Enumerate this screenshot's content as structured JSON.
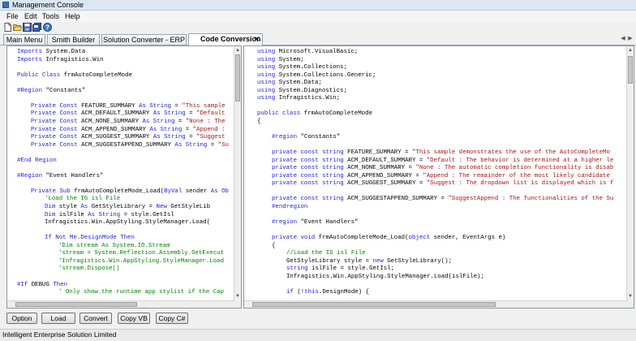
{
  "window": {
    "title": "Management Console"
  },
  "menu": [
    "File",
    "Edit",
    "Tools",
    "Help"
  ],
  "toolbar_icons": [
    "new-file-icon",
    "open-folder-icon",
    "save-icon",
    "save-all-icon",
    "help-icon"
  ],
  "tabs": [
    {
      "label": "Main Menu",
      "active": false
    },
    {
      "label": "Smith Builder",
      "active": false
    },
    {
      "label": "Solution Converter - ERP",
      "active": false
    },
    {
      "label": "Code Conversion",
      "active": true
    }
  ],
  "tab_close_glyph": "✕",
  "tab_nav_glyphs": [
    "◀",
    "▶"
  ],
  "scroll_glyphs": {
    "up": "▲",
    "down": "▼"
  },
  "vb_code": [
    {
      "y": 0,
      "x": 0,
      "t": [
        [
          "kw",
          "Imports "
        ],
        [
          "tx",
          "System.Data"
        ]
      ]
    },
    {
      "y": 1,
      "x": 0,
      "t": [
        [
          "kw",
          "Imports "
        ],
        [
          "tx",
          "Infragistics.Win"
        ]
      ]
    },
    {
      "y": 3,
      "x": 0,
      "t": [
        [
          "kw",
          "Public Class "
        ],
        [
          "tx",
          "frmAutoCompleteMode"
        ]
      ]
    },
    {
      "y": 5,
      "x": 0,
      "t": [
        [
          "kw",
          "#Region "
        ],
        [
          "tx",
          "\"Constants\""
        ]
      ]
    },
    {
      "y": 7,
      "x": 2,
      "t": [
        [
          "kw",
          "Private Const "
        ],
        [
          "tx",
          "FEATURE_SUMMARY "
        ],
        [
          "kw",
          "As String"
        ],
        [
          "tx",
          " = "
        ],
        [
          "str",
          "\"This sample"
        ]
      ]
    },
    {
      "y": 8,
      "x": 2,
      "t": [
        [
          "kw",
          "Private Const "
        ],
        [
          "tx",
          "ACM_DEFAULT_SUMMARY "
        ],
        [
          "kw",
          "As String"
        ],
        [
          "tx",
          " = "
        ],
        [
          "str",
          "\"Default"
        ]
      ]
    },
    {
      "y": 9,
      "x": 2,
      "t": [
        [
          "kw",
          "Private Const "
        ],
        [
          "tx",
          "ACM_NONE_SUMMARY "
        ],
        [
          "kw",
          "As String"
        ],
        [
          "tx",
          " = "
        ],
        [
          "str",
          "\"None : The"
        ]
      ]
    },
    {
      "y": 10,
      "x": 2,
      "t": [
        [
          "kw",
          "Private Const "
        ],
        [
          "tx",
          "ACM_APPEND_SUMMARY "
        ],
        [
          "kw",
          "As String"
        ],
        [
          "tx",
          " = "
        ],
        [
          "str",
          "\"Append :"
        ]
      ]
    },
    {
      "y": 11,
      "x": 2,
      "t": [
        [
          "kw",
          "Private Const "
        ],
        [
          "tx",
          "ACM_SUGGEST_SUMMARY "
        ],
        [
          "kw",
          "As String"
        ],
        [
          "tx",
          " = "
        ],
        [
          "str",
          "\"Suggest"
        ]
      ]
    },
    {
      "y": 12,
      "x": 2,
      "t": [
        [
          "kw",
          "Private Const "
        ],
        [
          "tx",
          "ACM_SUGGESTAPPEND_SUMMARY "
        ],
        [
          "kw",
          "As String"
        ],
        [
          "tx",
          " = "
        ],
        [
          "str",
          "\"Su"
        ]
      ]
    },
    {
      "y": 14,
      "x": 0,
      "t": [
        [
          "kw",
          "#End Region"
        ]
      ]
    },
    {
      "y": 16,
      "x": 0,
      "t": [
        [
          "kw",
          "#Region "
        ],
        [
          "tx",
          "\"Event Handlers\""
        ]
      ]
    },
    {
      "y": 18,
      "x": 2,
      "t": [
        [
          "kw",
          "Private Sub "
        ],
        [
          "tx",
          "frmAutoCompleteMode_Load("
        ],
        [
          "kw",
          "ByVal "
        ],
        [
          "tx",
          "sender "
        ],
        [
          "kw",
          "As Ob"
        ]
      ]
    },
    {
      "y": 19,
      "x": 4,
      "t": [
        [
          "cm",
          "'Load the IG isl File"
        ]
      ]
    },
    {
      "y": 20,
      "x": 4,
      "t": [
        [
          "kw",
          "Dim "
        ],
        [
          "tx",
          "style "
        ],
        [
          "kw",
          "As "
        ],
        [
          "tx",
          "GetStyleLibrary = "
        ],
        [
          "kw",
          "New "
        ],
        [
          "tx",
          "GetStyleLib"
        ]
      ]
    },
    {
      "y": 21,
      "x": 4,
      "t": [
        [
          "kw",
          "Dim "
        ],
        [
          "tx",
          "islFile "
        ],
        [
          "kw",
          "As String"
        ],
        [
          "tx",
          " = style.GetIsl"
        ]
      ]
    },
    {
      "y": 22,
      "x": 4,
      "t": [
        [
          "tx",
          "Infragistics.Win.AppStyling.StyleManager.Load("
        ]
      ]
    },
    {
      "y": 24,
      "x": 4,
      "t": [
        [
          "kw",
          "If Not Me"
        ],
        [
          "tx",
          "."
        ],
        [
          "kw",
          "DesignMode Then"
        ]
      ]
    },
    {
      "y": 25,
      "x": 6,
      "t": [
        [
          "cm",
          "'Dim stream As System.IO.Stream"
        ]
      ]
    },
    {
      "y": 26,
      "x": 6,
      "t": [
        [
          "cm",
          "'stream = System.Reflection.Assembly.GetExecut"
        ]
      ]
    },
    {
      "y": 27,
      "x": 6,
      "t": [
        [
          "cm",
          "'Infragistics.Win.AppStyling.StyleManager.Load"
        ]
      ]
    },
    {
      "y": 28,
      "x": 6,
      "t": [
        [
          "cm",
          "'stream.Dispose()"
        ]
      ]
    },
    {
      "y": 30,
      "x": 0,
      "t": [
        [
          "kw",
          "#If "
        ],
        [
          "tx",
          "DEBUG "
        ],
        [
          "kw",
          "Then"
        ]
      ]
    },
    {
      "y": 31,
      "x": 6,
      "t": [
        [
          "cm",
          "' Only show the runtime app stylist if the Cap"
        ]
      ]
    }
  ],
  "cs_code": [
    {
      "y": 0,
      "x": 0,
      "t": [
        [
          "kw",
          "using "
        ],
        [
          "tx",
          "Microsoft.VisualBasic;"
        ]
      ]
    },
    {
      "y": 1,
      "x": 0,
      "t": [
        [
          "kw",
          "using "
        ],
        [
          "tx",
          "System;"
        ]
      ]
    },
    {
      "y": 2,
      "x": 0,
      "t": [
        [
          "kw",
          "using "
        ],
        [
          "tx",
          "System.Collections;"
        ]
      ]
    },
    {
      "y": 3,
      "x": 0,
      "t": [
        [
          "kw",
          "using "
        ],
        [
          "tx",
          "System.Collections.Generic;"
        ]
      ]
    },
    {
      "y": 4,
      "x": 0,
      "t": [
        [
          "kw",
          "using "
        ],
        [
          "tx",
          "System.Data;"
        ]
      ]
    },
    {
      "y": 5,
      "x": 0,
      "t": [
        [
          "kw",
          "using "
        ],
        [
          "tx",
          "System.Diagnostics;"
        ]
      ]
    },
    {
      "y": 6,
      "x": 0,
      "t": [
        [
          "kw",
          "using "
        ],
        [
          "tx",
          "Infragistics.Win;"
        ]
      ]
    },
    {
      "y": 8,
      "x": 0,
      "t": [
        [
          "kw",
          "public class "
        ],
        [
          "tx",
          "frmAutoCompleteMode"
        ]
      ]
    },
    {
      "y": 9,
      "x": 0,
      "t": [
        [
          "tx",
          "{"
        ]
      ]
    },
    {
      "y": 11,
      "x": 2,
      "t": [
        [
          "kw",
          "#region "
        ],
        [
          "tx",
          "\"Constants\""
        ]
      ]
    },
    {
      "y": 13,
      "x": 2,
      "t": [
        [
          "kw",
          "private const string "
        ],
        [
          "tx",
          "FEATURE_SUMMARY = "
        ],
        [
          "str",
          "\"This sample demonstrates the use of the AutoCompleteMo"
        ]
      ]
    },
    {
      "y": 14,
      "x": 2,
      "t": [
        [
          "kw",
          "private const string "
        ],
        [
          "tx",
          "ACM_DEFAULT_SUMMARY = "
        ],
        [
          "str",
          "\"Default : The behavior is determined at a higher le"
        ]
      ]
    },
    {
      "y": 15,
      "x": 2,
      "t": [
        [
          "kw",
          "private const string "
        ],
        [
          "tx",
          "ACM_NONE_SUMMARY = "
        ],
        [
          "str",
          "\"None : The automatic completion functionality is disab"
        ]
      ]
    },
    {
      "y": 16,
      "x": 2,
      "t": [
        [
          "kw",
          "private const string "
        ],
        [
          "tx",
          "ACM_APPEND_SUMMARY = "
        ],
        [
          "str",
          "\"Append : The remainder of the most likely candidate"
        ]
      ]
    },
    {
      "y": 17,
      "x": 2,
      "t": [
        [
          "kw",
          "private const string "
        ],
        [
          "tx",
          "ACM_SUGGEST_SUMMARY = "
        ],
        [
          "str",
          "\"Suggest : The dropdown list is displayed which is f"
        ]
      ]
    },
    {
      "y": 19,
      "x": 2,
      "t": [
        [
          "kw",
          "private const string "
        ],
        [
          "tx",
          "ACM_SUGGESTAPPEND_SUMMARY = "
        ],
        [
          "str",
          "\"SuggestAppend : The functionalities of the Su"
        ]
      ]
    },
    {
      "y": 20,
      "x": 2,
      "t": [
        [
          "kw",
          "#endregion"
        ]
      ]
    },
    {
      "y": 22,
      "x": 2,
      "t": [
        [
          "kw",
          "#region "
        ],
        [
          "tx",
          "\"Event Handlers\""
        ]
      ]
    },
    {
      "y": 24,
      "x": 2,
      "t": [
        [
          "kw",
          "private void "
        ],
        [
          "tx",
          "frmAutoCompleteMode_Load("
        ],
        [
          "kw",
          "object "
        ],
        [
          "tx",
          "sender, EventArgs e)"
        ]
      ]
    },
    {
      "y": 25,
      "x": 2,
      "t": [
        [
          "tx",
          "{"
        ]
      ]
    },
    {
      "y": 26,
      "x": 4,
      "t": [
        [
          "cm",
          "//Load the IG isl File"
        ]
      ]
    },
    {
      "y": 27,
      "x": 4,
      "t": [
        [
          "tx",
          "GetStyleLibrary style = "
        ],
        [
          "kw",
          "new "
        ],
        [
          "tx",
          "GetStyleLibrary();"
        ]
      ]
    },
    {
      "y": 28,
      "x": 4,
      "t": [
        [
          "kw",
          "string "
        ],
        [
          "tx",
          "islFile = style.GetIsl;"
        ]
      ]
    },
    {
      "y": 29,
      "x": 4,
      "t": [
        [
          "tx",
          "Infragistics.Win.AppStyling.StyleManager.Load(islFile);"
        ]
      ]
    },
    {
      "y": 31,
      "x": 4,
      "t": [
        [
          "kw",
          "if "
        ],
        [
          "tx",
          "(!"
        ],
        [
          "kw",
          "this"
        ],
        [
          "tx",
          ".DesignMode) {"
        ]
      ]
    }
  ],
  "buttons": [
    {
      "label": "Option"
    },
    {
      "label": "Load"
    },
    {
      "label": "Convert"
    },
    {
      "label": "Copy VB"
    },
    {
      "label": "Copy C#"
    }
  ],
  "status": {
    "text": "Intelligent Enterprise Solution Limited"
  },
  "colors": {
    "keyword": "#1f22d6",
    "string": "#a31515",
    "comment": "#008000",
    "accent": "#3c73b8"
  }
}
